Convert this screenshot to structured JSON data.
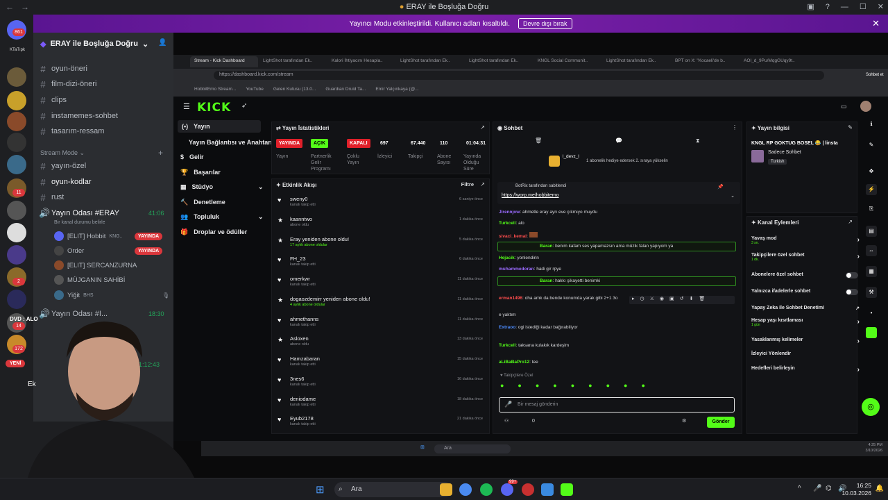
{
  "window": {
    "title": "ERAY ile Boşluğa Doğru",
    "back": "←",
    "forward": "→"
  },
  "notice": {
    "text": "Yayıncı Modu etkinleştirildi. Kullanıcı adları kısaltıldı.",
    "button": "Devre dışı bırak"
  },
  "servers": {
    "home_badge": "861",
    "tag": "KTaTıpk",
    "badges": [
      "11",
      "2",
      "14",
      "172"
    ],
    "yeni": "YENİ"
  },
  "sidebar": {
    "server_name": "ERAY ile Boşluğa Doğru",
    "channels": [
      {
        "name": "oyun-öneri",
        "icon": "📱"
      },
      {
        "name": "film-dizi-öneri",
        "icon": "📱"
      },
      {
        "name": "clips",
        "icon": "📱"
      },
      {
        "name": "instamemes-sohbet",
        "icon": "📷"
      },
      {
        "name": "tasarım-ressam",
        "icon": "🎨"
      }
    ],
    "stream_mode_label": "Stream Mode",
    "stream_channels": [
      "yayın-özel",
      "oyun-kodlar",
      "rust"
    ],
    "voice_channel": {
      "name": "Yayın Odası #ERAY",
      "time": "41:06",
      "status": "Bir kanal durumu belirle"
    },
    "voice_users": [
      {
        "name": "[ELIT] Hobbit",
        "extra": "KNG..",
        "live": "YAYINDA"
      },
      {
        "name": "Order",
        "extra": "",
        "live": "YAYINDA"
      },
      {
        "name": "[ELIT] SERCANZURNA",
        "extra": "",
        "live": ""
      },
      {
        "name": "MÜJGANIN SAHİBİ",
        "extra": "",
        "live": ""
      },
      {
        "name": "Yiğit",
        "extra": "BHS",
        "live": ""
      }
    ],
    "voice_channel2": {
      "name": "Yayın Odası #I...",
      "time": "18:30"
    },
    "voice_channel3": {
      "time": "1:12:43"
    },
    "overlay_text": "DVD : ALO",
    "user_short": "Ek"
  },
  "browser": {
    "tabs": [
      "Stream - Kick Dashboard",
      "LightShot tarafından Ek..",
      "Kalori İhtiyacını Hesapla..",
      "LightShot tarafından Ek..",
      "LightShot tarafından Ek..",
      "KNGL Social Communit..",
      "LightShot tarafından Ek..",
      "BPT on X: \"Kocaeli'de b..",
      "AOI_d_9Pu/MqgGUqy9t.."
    ],
    "url": "https://dashboard.kick.com/stream",
    "bookmarks": [
      "HobbitEmo Stream...",
      "YouTube",
      "Gelen Kutusu (13.0...",
      "Guardian Druid Ta...",
      "Emir Yalçınkaya (@..."
    ],
    "profile_btn": "Sohbet et"
  },
  "kick": {
    "logo": "KICK",
    "nav": [
      {
        "label": "Yayın",
        "icon": "(•)"
      },
      {
        "label": "Yayın Bağlantısı ve Anahtarı",
        "icon": ""
      },
      {
        "label": "Gelir",
        "icon": "$"
      },
      {
        "label": "Başarılar",
        "icon": "🏆"
      },
      {
        "label": "Stüdyo",
        "icon": "▦"
      },
      {
        "label": "Denetleme",
        "icon": "🔨"
      },
      {
        "label": "Topluluk",
        "icon": "👥"
      },
      {
        "label": "Droplar ve ödüller",
        "icon": "🎁"
      }
    ],
    "stats_title": "Yayın İstatistikleri",
    "stats": [
      {
        "value": "YAYINDA",
        "label": "Yayın",
        "color": "#e0202a"
      },
      {
        "value": "AÇIK",
        "label": "Partnerlik Gelir Programı",
        "color": "#53fc18"
      },
      {
        "value": "KAPALI",
        "label": "Çoklu Yayın",
        "color": "#e0202a"
      },
      {
        "value": "697",
        "label": "İzleyici",
        "color": ""
      },
      {
        "value": "67.440",
        "label": "Takipçi",
        "color": ""
      },
      {
        "value": "110",
        "label": "Abone Sayısı",
        "color": ""
      },
      {
        "value": "01:04:31",
        "label": "Yayında Olduğu Süre",
        "color": ""
      }
    ],
    "feed_title": "Etkinlik Akışı",
    "feed_filter": "Filtre",
    "feed": [
      {
        "user": "sweny0",
        "desc": "kanalı takip etti",
        "time": "6 saniye önce"
      },
      {
        "user": "kaanntwo",
        "desc": "abone oldu",
        "time": "1 dakika önce"
      },
      {
        "user": "Eray yeniden abone oldu!",
        "desc": "17 aylık abone oldular",
        "time": "5 dakika önce"
      },
      {
        "user": "FH_23",
        "desc": "kanalı takip etti",
        "time": "6 dakika önce"
      },
      {
        "user": "omerkwr",
        "desc": "kanalı takip etti",
        "time": "11 dakika önce"
      },
      {
        "user": "dogaozdemirr yeniden abone oldu!",
        "desc": "4 aylık abone oldular",
        "time": "11 dakika önce"
      },
      {
        "user": "ahmethanns",
        "desc": "kanalı takip etti",
        "time": "11 dakika önce"
      },
      {
        "user": "Asloxen",
        "desc": "abone oldu",
        "time": "13 dakika önce"
      },
      {
        "user": "Hamzabaran",
        "desc": "kanalı takip etti",
        "time": "15 dakika önce"
      },
      {
        "user": "3nes6",
        "desc": "kanalı takip etti",
        "time": "16 dakika önce"
      },
      {
        "user": "deniodame",
        "desc": "kanalı takip etti",
        "time": "18 dakika önce"
      },
      {
        "user": "Eyub2178",
        "desc": "kanalı takip etti",
        "time": "21 dakika önce"
      }
    ],
    "chat_title": "Sohbet",
    "chat_gift": "1 abonelik hediye edersek 2. sıraya yükselin",
    "chat_gift_user": "l_devz_l",
    "pinned_by": "BotRix tarafından sabitlendi",
    "pinned_link": "https://worp.me/hobbitemo",
    "chat": [
      {
        "user": "Jirennjow",
        "text": "ahmetle eray ayrı eve çıkmıyo muydu",
        "color": "#9b6bff",
        "hl": false
      },
      {
        "user": "Turkcell",
        "text": "alo",
        "color": "#53fc18",
        "hl": false
      },
      {
        "user": "sivaci_kemal",
        "text": "",
        "color": "#ff4d4d",
        "hl": false
      },
      {
        "user": "Baran",
        "text": "benim kafam ses yapamazsın ama müzik falan yapıyom ya",
        "color": "#53fc18",
        "hl": true
      },
      {
        "user": "Hejacik",
        "text": "yonlendirin",
        "color": "#53fc18",
        "hl": false
      },
      {
        "user": "muhammedoran",
        "text": "hadi gir rpye",
        "color": "#9b6bff",
        "hl": false
      },
      {
        "user": "Baran",
        "text": "hakkı şikayetti benimki",
        "color": "#53fc18",
        "hl": true
      },
      {
        "user": "erman1496",
        "text": "oha amk da bende konumda yarak gibi 2+1 3o",
        "color": "#ff4d4d",
        "hl": false
      },
      {
        "user": "",
        "text": "e yaktım",
        "color": "#ff4d4d",
        "hl": false
      },
      {
        "user": "Extraoo",
        "text": "ogi istediği kadar bağırabiliyor",
        "color": "#4d8dff",
        "hl": false
      },
      {
        "user": "Turkcell",
        "text": "taksana kulakık kardeşim",
        "color": "#53fc18",
        "hl": false
      },
      {
        "user": "aLiBaBaPro12",
        "text": "tee",
        "color": "#53fc18",
        "hl": false
      }
    ],
    "chat_followers": "Takipçilere Özel",
    "chat_placeholder": "Bir mesaj gönderin",
    "chat_send": "Gönder",
    "chat_count": "0",
    "info_title": "Yayın bilgisi",
    "info_stream_title": "KNGL RP GOKTUG BOSEL 😂 | linsta",
    "info_mode": "Sadece Sohbet",
    "info_lang": "Turkish",
    "actions_title": "Kanal Eylemleri",
    "actions": [
      {
        "label": "Yavaş mod",
        "sub": "3 sn.",
        "type": "arrow"
      },
      {
        "label": "Takipçilere özel sohbet",
        "sub": "1 dk.",
        "type": "arrow"
      },
      {
        "label": "Abonelere özel sohbet",
        "sub": "",
        "type": "toggle"
      },
      {
        "label": "Yalnızca ifadelerle sohbet",
        "sub": "",
        "type": "toggle"
      },
      {
        "label": "Yapay Zeka ile Sohbet Denetimi",
        "sub": "",
        "type": "ext"
      },
      {
        "label": "Hesap yaşı kısıtlaması",
        "sub": "1 gün",
        "type": "arrow"
      },
      {
        "label": "Yasaklanmış kelimeler",
        "sub": "",
        "type": "arrow"
      },
      {
        "label": "İzleyici Yönlendir",
        "sub": "",
        "type": "none"
      },
      {
        "label": "Hedefleri belirleyin",
        "sub": "",
        "type": "arrow"
      }
    ]
  },
  "inner_taskbar": {
    "search": "Ara",
    "time": "4:25 PM",
    "date": "3/10/2026"
  },
  "taskbar": {
    "search": "Ara",
    "time": "16:25",
    "date": "10.03.2026",
    "notif_badge": "99+"
  }
}
